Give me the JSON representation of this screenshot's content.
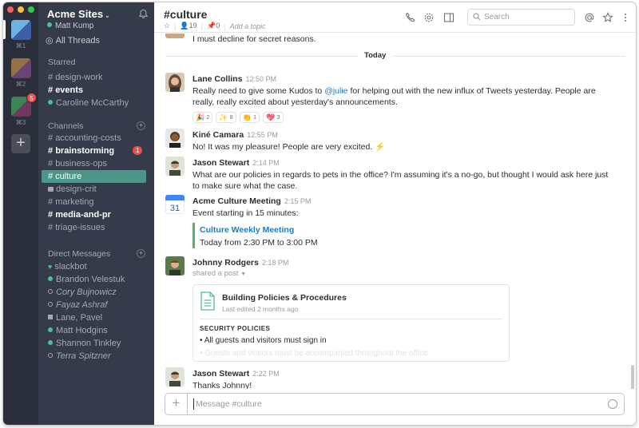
{
  "teams": [
    {
      "key": "⌘1",
      "color_a": "#6fb3e0",
      "color_b": "#3d5fa9",
      "active": true
    },
    {
      "key": "⌘2",
      "color_a": "#b5894a",
      "color_b": "#7d4b8a",
      "active": false
    },
    {
      "key": "⌘3",
      "color_a": "#3fa060",
      "color_b": "#8a3a6a",
      "active": false,
      "badge": "5"
    }
  ],
  "workspace": {
    "name": "Acme Sites",
    "user": "Matt Kump",
    "all_threads": "All Threads"
  },
  "sidebar": {
    "starred_title": "Starred",
    "starred": [
      {
        "label": "design-work",
        "prefix": "#"
      },
      {
        "label": "events",
        "prefix": "#",
        "bold": true
      },
      {
        "label": "Caroline McCarthy",
        "prefix": "presence"
      }
    ],
    "channels_title": "Channels",
    "channels": [
      {
        "label": "accounting-costs",
        "prefix": "#"
      },
      {
        "label": "brainstorming",
        "prefix": "#",
        "bold": true,
        "badge": "1"
      },
      {
        "label": "business-ops",
        "prefix": "#"
      },
      {
        "label": "culture",
        "prefix": "#",
        "active": true
      },
      {
        "label": "design-crit",
        "prefix": "lock"
      },
      {
        "label": "marketing",
        "prefix": "#"
      },
      {
        "label": "media-and-pr",
        "prefix": "#",
        "bold": true
      },
      {
        "label": "triage-issues",
        "prefix": "#"
      }
    ],
    "dm_title": "Direct Messages",
    "dms": [
      {
        "label": "slackbot",
        "prefix": "heart"
      },
      {
        "label": "Brandon Velestuk",
        "prefix": "presence"
      },
      {
        "label": "Cory Bujnowicz",
        "prefix": "away",
        "italic": true
      },
      {
        "label": "Fayaz Ashraf",
        "prefix": "away",
        "italic": true
      },
      {
        "label": "Lane, Pavel",
        "prefix": "square"
      },
      {
        "label": "Matt Hodgins",
        "prefix": "presence"
      },
      {
        "label": "Shannon Tinkley",
        "prefix": "presence"
      },
      {
        "label": "Terra Spitzner",
        "prefix": "away",
        "italic": true
      }
    ]
  },
  "header": {
    "channel": "#culture",
    "members": "19",
    "pins": "0",
    "topic_placeholder": "Add a topic",
    "search_placeholder": "Search"
  },
  "messages": {
    "prev_tail": "I must decline for secret reasons.",
    "day_label": "Today",
    "lane": {
      "author": "Lane Collins",
      "time": "12:50 PM",
      "text_before": "Really need to give some Kudos to ",
      "mention": "@julie",
      "text_after": " for helping out with the new influx of Tweets yesterday. People are really, really excited about yesterday's announcements.",
      "reactions": [
        {
          "emoji": "🎉",
          "count": "2",
          "icon": "party-popper-icon"
        },
        {
          "emoji": "✨",
          "count": "8",
          "icon": "sparkles-icon"
        },
        {
          "emoji": "👏",
          "count": "1",
          "icon": "clapping-hands-icon"
        },
        {
          "emoji": "💖",
          "count": "3",
          "icon": "sparkling-heart-icon"
        }
      ]
    },
    "kine": {
      "author": "Kiné Camara",
      "time": "12:55 PM",
      "text": "No! It was my pleasure! People are very excited. ⚡"
    },
    "jason1": {
      "author": "Jason Stewart",
      "time": "2:14 PM",
      "text": "What are our policies in regards to pets in the office? I'm assuming it's a no-go, but thought I would ask here just to make sure what the case."
    },
    "meeting": {
      "author": "Acme Culture Meeting",
      "time": "2:15 PM",
      "calendar_day": "31",
      "text": "Event starting in 15 minutes:",
      "event_title": "Culture Weekly Meeting",
      "event_time": "Today from 2:30 PM to 3:00 PM"
    },
    "johnny": {
      "author": "Johnny Rodgers",
      "time": "2:18 PM",
      "shared": "shared a post",
      "post_title": "Building Policies & Procedures",
      "post_sub": "Last edited 2 months ago",
      "post_heading": "SECURITY POLICIES",
      "post_line": "• All guests and visitors must sign in",
      "post_fade": "• Guests and visitors must be accompanied throughout the office"
    },
    "jason2": {
      "author": "Jason Stewart",
      "time": "2:22 PM",
      "text": "Thanks Johnny!"
    }
  },
  "composer": {
    "placeholder": "Message #culture"
  },
  "colors": {
    "sidebar_bg": "#363b4c",
    "rail_bg": "#2b2f3c",
    "active_channel": "#4c9689",
    "badge": "#e8504b",
    "link": "#1d7bc2",
    "event_bar": "#56b36b"
  }
}
